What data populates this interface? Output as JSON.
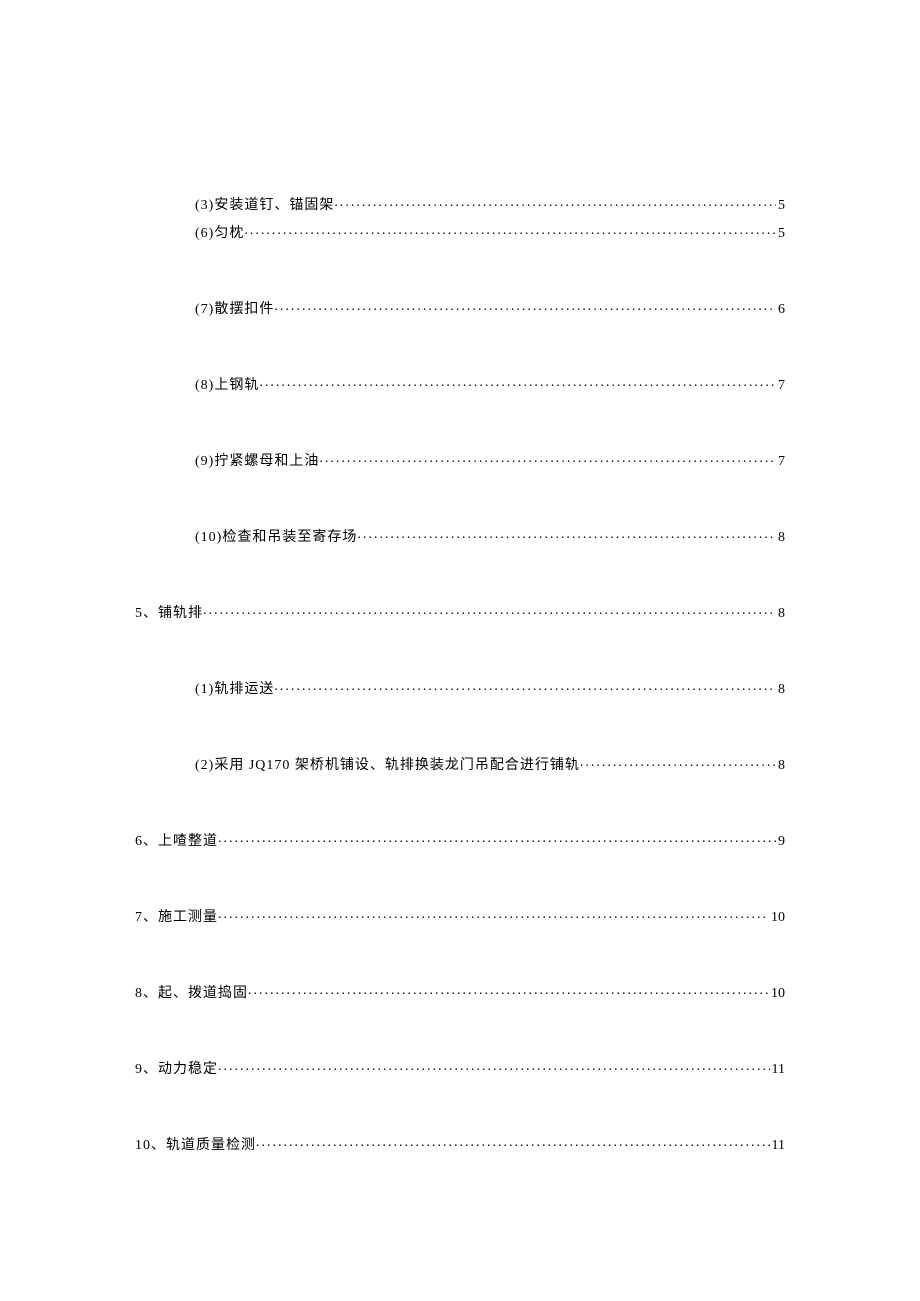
{
  "toc": [
    {
      "level": 2,
      "label": "(3)安装道钉、锚固架",
      "page": "5",
      "tight": true
    },
    {
      "level": 2,
      "label": "(6)匀枕",
      "page": "5"
    },
    {
      "level": 2,
      "label": "(7)散摆扣件",
      "page": "6"
    },
    {
      "level": 2,
      "label": "(8)上钢轨",
      "page": "7"
    },
    {
      "level": 2,
      "label": "(9)拧紧螺母和上油",
      "page": "7"
    },
    {
      "level": 2,
      "label": "(10)检查和吊装至寄存场",
      "page": "8"
    },
    {
      "level": 1,
      "label": "5、铺轨排",
      "page": "8"
    },
    {
      "level": 2,
      "label": "(1)轨排运送",
      "page": "8"
    },
    {
      "level": 2,
      "label": "(2)采用 JQ170 架桥机铺设、轨排换装龙门吊配合进行铺轨",
      "page": "8"
    },
    {
      "level": 1,
      "label": "6、上喳整道",
      "page": "9"
    },
    {
      "level": 1,
      "label": "7、施工测量",
      "page": "10"
    },
    {
      "level": 1,
      "label": "8、起、拨道捣固",
      "page": "10"
    },
    {
      "level": 1,
      "label": "9、动力稳定",
      "page": "11"
    },
    {
      "level": 1,
      "label": "10、轨道质量检测",
      "page": "11"
    }
  ]
}
